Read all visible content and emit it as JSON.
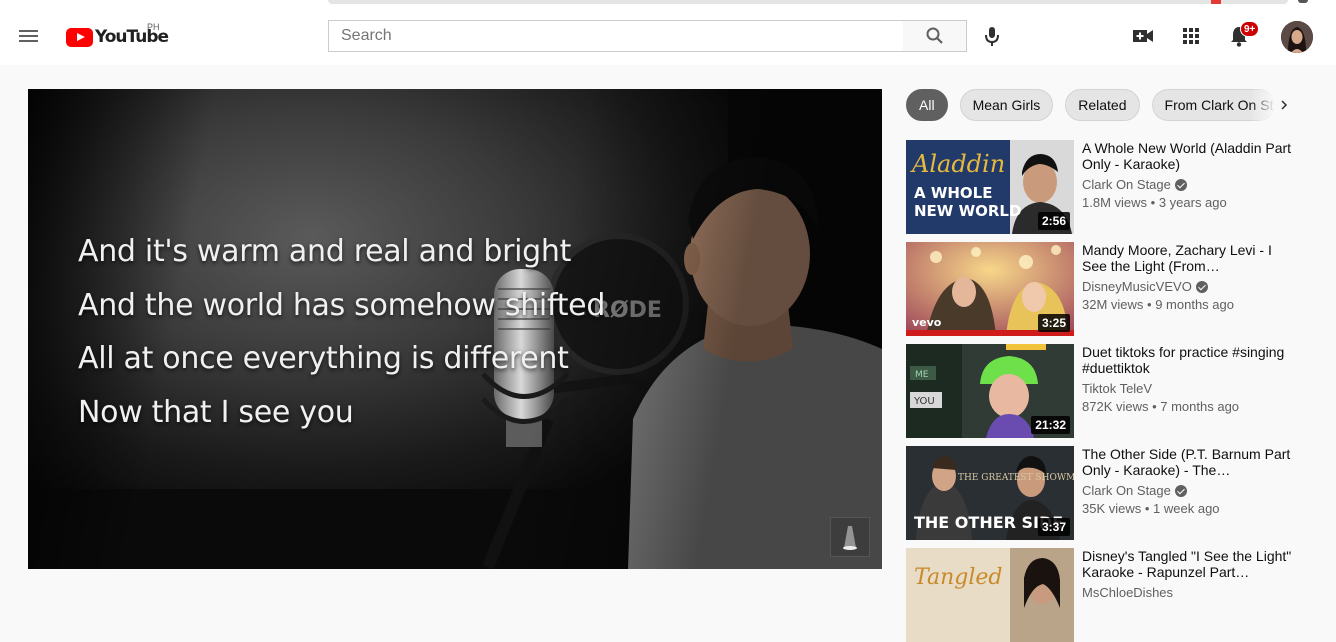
{
  "masthead": {
    "logo_text": "YouTube",
    "region": "PH",
    "search_placeholder": "Search",
    "notification_count": "9+"
  },
  "player": {
    "lyrics": [
      "And it's warm and real and bright",
      "And the world has somehow shifted",
      "All at once everything is different",
      "Now that I see you"
    ],
    "mic_brand": "RØDE"
  },
  "chips": [
    "All",
    "Mean Girls",
    "Related",
    "From Clark On Stage"
  ],
  "related": [
    {
      "title": "A Whole New World (Aladdin Part Only - Karaoke)",
      "channel": "Clark On Stage",
      "verified": true,
      "views": "1.8M views",
      "age": "3 years ago",
      "duration": "2:56",
      "thumb_text": [
        "Aladdin",
        "A WHOLE",
        "NEW WORLD"
      ]
    },
    {
      "title": "Mandy Moore, Zachary Levi - I See the Light (From…",
      "channel": "DisneyMusicVEVO",
      "verified": true,
      "views": "32M views",
      "age": "9 months ago",
      "duration": "3:25",
      "thumb_text": [
        "vevo"
      ]
    },
    {
      "title": "Duet tiktoks for practice #singing #duettiktok",
      "channel": "Tiktok TeleV",
      "verified": false,
      "views": "872K views",
      "age": "7 months ago",
      "duration": "21:32",
      "thumb_text": [
        "ME",
        "YOU"
      ]
    },
    {
      "title": "The Other Side (P.T. Barnum Part Only - Karaoke) - The…",
      "channel": "Clark On Stage",
      "verified": true,
      "views": "35K views",
      "age": "1 week ago",
      "duration": "3:37",
      "thumb_text": [
        "THE GREATEST SHOWMAN",
        "THE OTHER SIDE"
      ]
    },
    {
      "title": "Disney's Tangled \"I See the Light\" Karaoke - Rapunzel Part…",
      "channel": "MsChloeDishes",
      "verified": false,
      "views": "",
      "age": "",
      "duration": "",
      "thumb_text": [
        "Tangled"
      ]
    }
  ]
}
